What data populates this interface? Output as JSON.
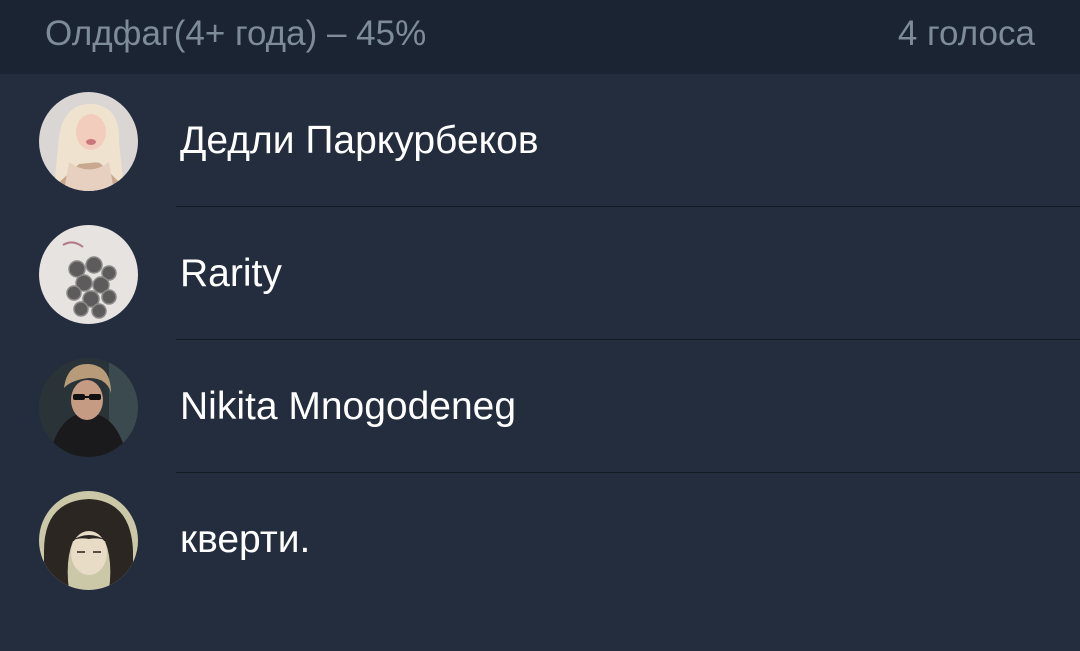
{
  "header": {
    "title": "Олдфаг(4+ года) – 45%",
    "votes": "4 голоса",
    "fill_fraction": 0.45
  },
  "voters": [
    {
      "name": "Дедли Паркурбеков",
      "avatar": "avatar-blonde-person-photo"
    },
    {
      "name": "Rarity",
      "avatar": "avatar-coins-photo"
    },
    {
      "name": "Nikita Mnogodeneg",
      "avatar": "avatar-person-sunglasses-photo"
    },
    {
      "name": "кверти.",
      "avatar": "avatar-anime-character-image"
    }
  ]
}
